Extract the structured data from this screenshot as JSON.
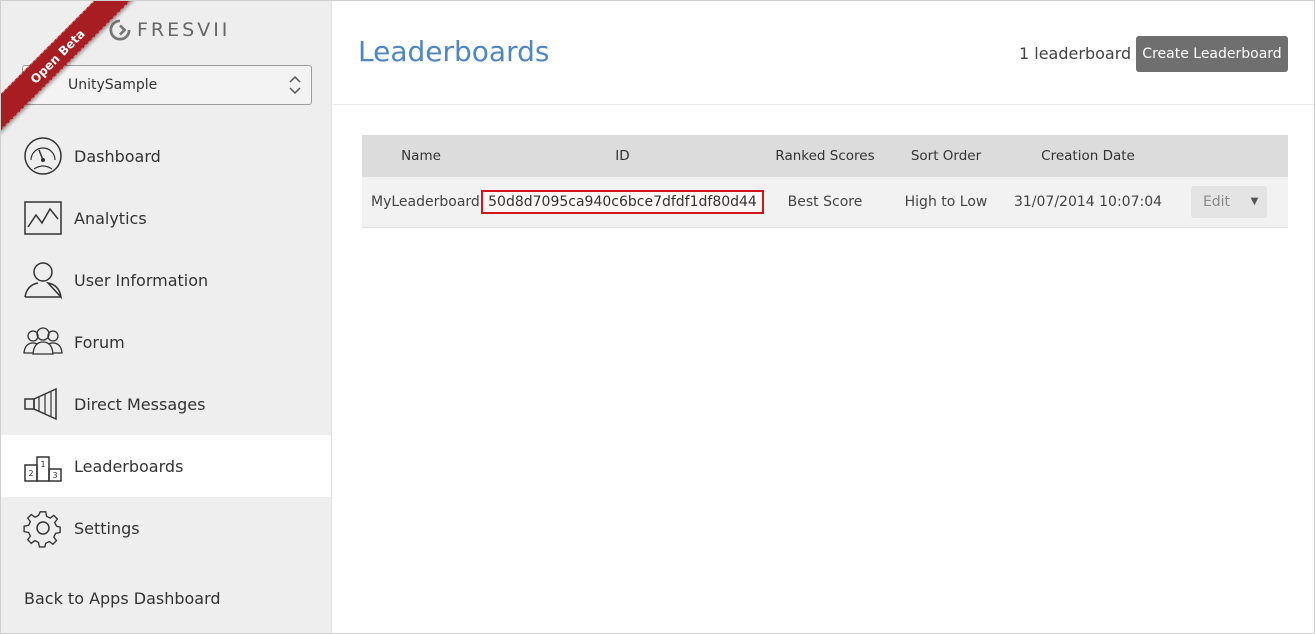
{
  "brand": {
    "name": "FRESVII",
    "ribbon": "Open Beta"
  },
  "app_selector": {
    "value": "UnitySample"
  },
  "sidebar": {
    "items": [
      {
        "label": "Dashboard",
        "icon": "gauge-icon",
        "active": false
      },
      {
        "label": "Analytics",
        "icon": "line-chart-icon",
        "active": false
      },
      {
        "label": "User Information",
        "icon": "user-icon",
        "active": false
      },
      {
        "label": "Forum",
        "icon": "group-icon",
        "active": false
      },
      {
        "label": "Direct Messages",
        "icon": "megaphone-icon",
        "active": false
      },
      {
        "label": "Leaderboards",
        "icon": "podium-icon",
        "active": true
      },
      {
        "label": "Settings",
        "icon": "gear-icon",
        "active": false
      }
    ],
    "back_link": "Back to Apps Dashboard"
  },
  "header": {
    "title": "Leaderboards",
    "count": "1 leaderboard",
    "create_button": "Create Leaderboard"
  },
  "table": {
    "columns": [
      "Name",
      "ID",
      "Ranked Scores",
      "Sort Order",
      "Creation Date",
      ""
    ],
    "rows": [
      {
        "name": "MyLeaderboard",
        "id": "50d8d7095ca940c6bce7dfdf1df80d44",
        "ranked_scores": "Best Score",
        "sort_order": "High to Low",
        "creation_date": "31/07/2014 10:07:04",
        "action": "Edit"
      }
    ]
  },
  "colors": {
    "accent": "#4f87c2",
    "ribbon": "#a81d22",
    "highlight": "#d4141b"
  }
}
